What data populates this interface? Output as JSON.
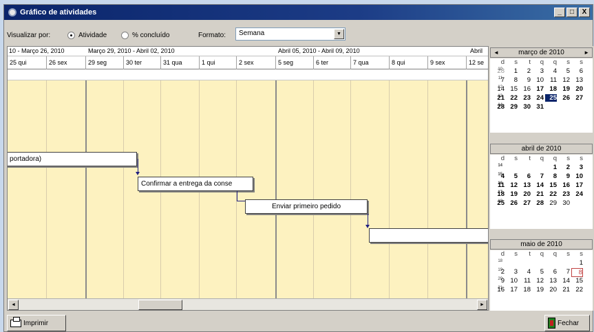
{
  "window": {
    "title": "Gráfico de atividades",
    "controls": [
      "_",
      "□",
      "X"
    ]
  },
  "toolbar": {
    "view_label": "Visualizar por:",
    "radio_activity": "Atividade",
    "radio_percent": "% concluído",
    "format_label": "Formato:",
    "format_value": "Semana",
    "selected_view": "Atividade"
  },
  "gantt": {
    "weeks": [
      "10 - Março 26, 2010",
      "Março 29, 2010 - Abril 02, 2010",
      "Abril 05, 2010 - Abril 09, 2010",
      "Abril"
    ],
    "days": [
      "25 qui",
      "26 sex",
      "29 seg",
      "30 ter",
      "31 qua",
      "1 qui",
      "2 sex",
      "5 seg",
      "6 ter",
      "7 qua",
      "8 qui",
      "9 sex",
      "12 se"
    ],
    "tasks": [
      {
        "label": "portadora)"
      },
      {
        "label": "Confirmar a entrega da conse"
      },
      {
        "label": "Enviar primeiro pedido"
      },
      {
        "label": ""
      }
    ]
  },
  "calendar": {
    "dow": [
      "d",
      "s",
      "t",
      "q",
      "q",
      "s",
      "s"
    ],
    "nav_prev": "◄",
    "nav_next": "►",
    "months": [
      {
        "title": "março de 2010",
        "weeks": [
          {
            "wk": "10",
            "days": [
              "28",
              "1",
              "2",
              "3",
              "4",
              "5",
              "6"
            ]
          },
          {
            "wk": "11",
            "days": [
              "7",
              "8",
              "9",
              "10",
              "11",
              "12",
              "13"
            ]
          },
          {
            "wk": "12",
            "days": [
              "14",
              "15",
              "16",
              "17",
              "18",
              "19",
              "20"
            ]
          },
          {
            "wk": "13",
            "days": [
              "21",
              "22",
              "23",
              "24",
              "25",
              "26",
              "27"
            ]
          },
          {
            "wk": "14",
            "days": [
              "28",
              "29",
              "30",
              "31",
              "",
              "",
              ""
            ]
          }
        ]
      },
      {
        "title": "abril de 2010",
        "weeks": [
          {
            "wk": "14",
            "days": [
              "",
              "",
              "",
              "",
              "1",
              "2",
              "3"
            ]
          },
          {
            "wk": "15",
            "days": [
              "4",
              "5",
              "6",
              "7",
              "8",
              "9",
              "10"
            ]
          },
          {
            "wk": "16",
            "days": [
              "11",
              "12",
              "13",
              "14",
              "15",
              "16",
              "17"
            ]
          },
          {
            "wk": "17",
            "days": [
              "18",
              "19",
              "20",
              "21",
              "22",
              "23",
              "24"
            ]
          },
          {
            "wk": "18",
            "days": [
              "25",
              "26",
              "27",
              "28",
              "29",
              "30",
              ""
            ]
          }
        ]
      },
      {
        "title": "maio de 2010",
        "weeks": [
          {
            "wk": "18",
            "days": [
              "",
              "",
              "",
              "",
              "",
              "",
              "1"
            ]
          },
          {
            "wk": "19",
            "days": [
              "2",
              "3",
              "4",
              "5",
              "6",
              "7",
              "8"
            ]
          },
          {
            "wk": "20",
            "days": [
              "9",
              "10",
              "11",
              "12",
              "13",
              "14",
              "15"
            ]
          },
          {
            "wk": "21",
            "days": [
              "16",
              "17",
              "18",
              "19",
              "20",
              "21",
              "22"
            ]
          }
        ]
      }
    ]
  },
  "bottom": {
    "print_label": "Imprimir",
    "close_label": "Fechar"
  }
}
